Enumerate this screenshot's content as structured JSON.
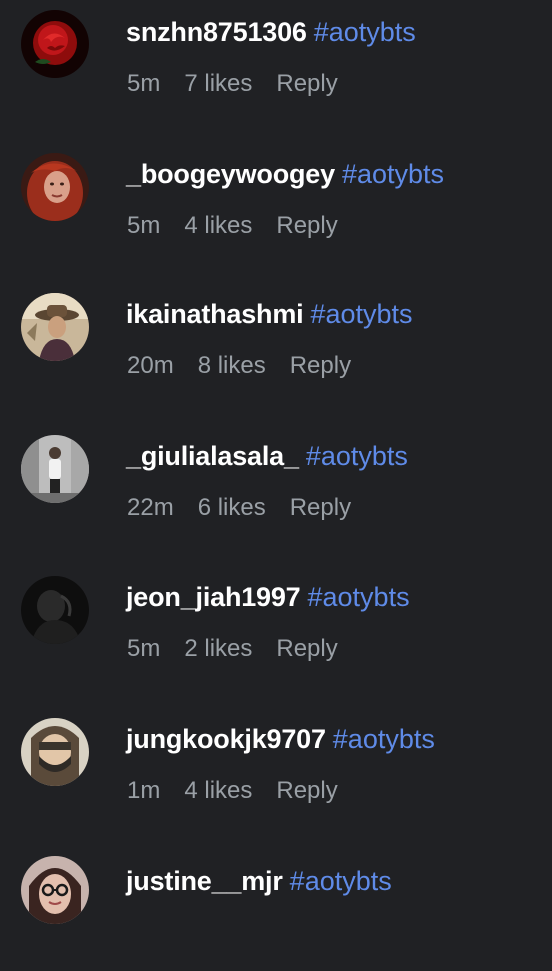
{
  "colors": {
    "background": "#202124",
    "username": "#ffffff",
    "hashtag": "#5f8be8",
    "meta": "#9aa0a6"
  },
  "comments": [
    {
      "username": "snzhn8751306",
      "text": "#aotybts",
      "time": "5m",
      "likes": "7 likes",
      "reply": "Reply",
      "avatar_icon": "red-rose-avatar"
    },
    {
      "username": "_boogeywoogey",
      "text": "#aotybts",
      "time": "5m",
      "likes": "4 likes",
      "reply": "Reply",
      "avatar_icon": "red-hair-portrait-avatar"
    },
    {
      "username": "ikainathashmi",
      "text": "#aotybts",
      "time": "20m",
      "likes": "8 likes",
      "reply": "Reply",
      "avatar_icon": "hat-portrait-avatar"
    },
    {
      "username": "_giulialasala_",
      "text": "#aotybts",
      "time": "22m",
      "likes": "6 likes",
      "reply": "Reply",
      "avatar_icon": "standing-figure-avatar"
    },
    {
      "username": "jeon_jiah1997",
      "text": "#aotybts",
      "time": "5m",
      "likes": "2 likes",
      "reply": "Reply",
      "avatar_icon": "dark-silhouette-avatar"
    },
    {
      "username": "jungkookjk9707",
      "text": "#aotybts",
      "time": "1m",
      "likes": "4 likes",
      "reply": "Reply",
      "avatar_icon": "masked-face-avatar"
    },
    {
      "username": "justine__mjr",
      "text": "#aotybts",
      "time": "",
      "likes": "",
      "reply": "",
      "avatar_icon": "glasses-portrait-avatar"
    }
  ]
}
